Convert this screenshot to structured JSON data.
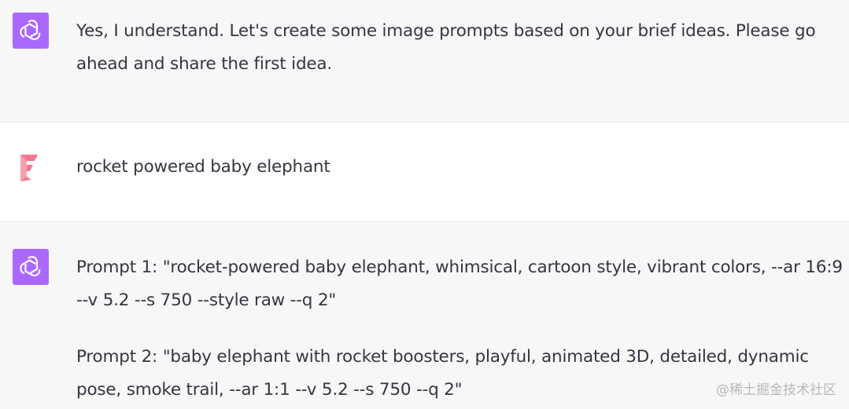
{
  "messages": [
    {
      "role": "assistant",
      "avatar_icon": "openai-logo-icon",
      "paragraphs": [
        "Yes, I understand. Let's create some image prompts based on your brief ideas. Please go ahead and share the first idea."
      ]
    },
    {
      "role": "user",
      "avatar_icon": "user-avatar-icon",
      "paragraphs": [
        "rocket powered baby elephant"
      ]
    },
    {
      "role": "assistant",
      "avatar_icon": "openai-logo-icon",
      "paragraphs": [
        "Prompt 1: \"rocket-powered baby elephant, whimsical, cartoon style, vibrant colors, --ar 16:9 --v 5.2 --s 750 --style raw --q 2\"",
        "Prompt 2: \"baby elephant with rocket boosters, playful, animated 3D, detailed, dynamic pose, smoke trail, --ar 1:1 --v 5.2 --s 750 --q 2\""
      ]
    }
  ],
  "watermark": "@稀土掘金技术社区",
  "colors": {
    "assistant_bg": "#f7f7f8",
    "user_bg": "#ffffff",
    "gpt_avatar": "#ab68ff",
    "user_avatar": "#f5778f"
  }
}
